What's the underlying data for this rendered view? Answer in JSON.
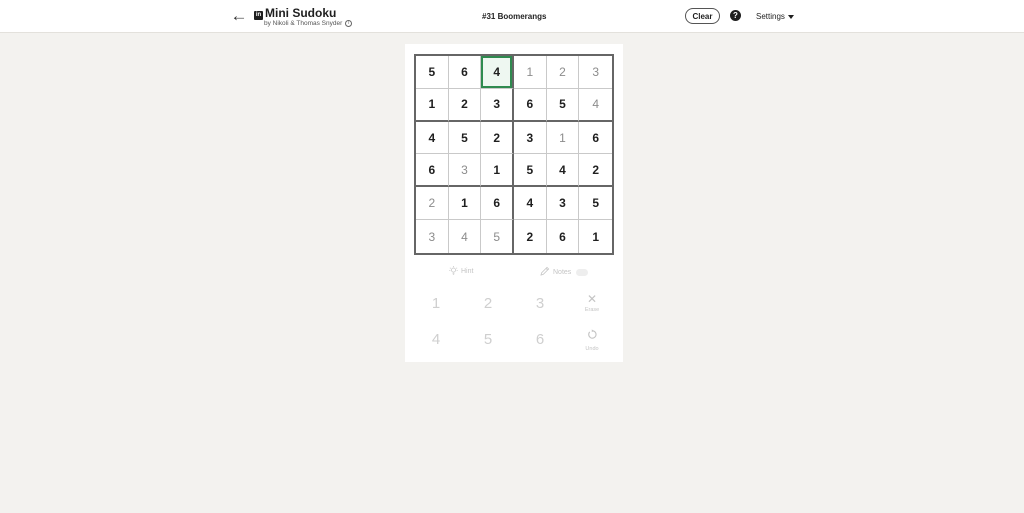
{
  "header": {
    "back_icon": "arrow-left-icon",
    "logo_text": "in",
    "title": "Mini Sudoku",
    "byline": "by Nikoli & Thomas Snyder",
    "info_glyph": "i",
    "puzzle_name": "#31 Boomerangs",
    "clear_label": "Clear",
    "help_glyph": "?",
    "settings_label": "Settings"
  },
  "grid": {
    "selected": [
      0,
      2
    ],
    "rows": [
      [
        {
          "v": "5",
          "t": "given"
        },
        {
          "v": "6",
          "t": "given"
        },
        {
          "v": "4",
          "t": "given"
        },
        {
          "v": "1",
          "t": "user"
        },
        {
          "v": "2",
          "t": "user"
        },
        {
          "v": "3",
          "t": "user"
        }
      ],
      [
        {
          "v": "1",
          "t": "given"
        },
        {
          "v": "2",
          "t": "given"
        },
        {
          "v": "3",
          "t": "given"
        },
        {
          "v": "6",
          "t": "given"
        },
        {
          "v": "5",
          "t": "given"
        },
        {
          "v": "4",
          "t": "user"
        }
      ],
      [
        {
          "v": "4",
          "t": "given"
        },
        {
          "v": "5",
          "t": "given"
        },
        {
          "v": "2",
          "t": "given"
        },
        {
          "v": "3",
          "t": "given"
        },
        {
          "v": "1",
          "t": "user"
        },
        {
          "v": "6",
          "t": "given"
        }
      ],
      [
        {
          "v": "6",
          "t": "given"
        },
        {
          "v": "3",
          "t": "user"
        },
        {
          "v": "1",
          "t": "given"
        },
        {
          "v": "5",
          "t": "given"
        },
        {
          "v": "4",
          "t": "given"
        },
        {
          "v": "2",
          "t": "given"
        }
      ],
      [
        {
          "v": "2",
          "t": "user"
        },
        {
          "v": "1",
          "t": "given"
        },
        {
          "v": "6",
          "t": "given"
        },
        {
          "v": "4",
          "t": "given"
        },
        {
          "v": "3",
          "t": "given"
        },
        {
          "v": "5",
          "t": "given"
        }
      ],
      [
        {
          "v": "3",
          "t": "user"
        },
        {
          "v": "4",
          "t": "user"
        },
        {
          "v": "5",
          "t": "user"
        },
        {
          "v": "2",
          "t": "given"
        },
        {
          "v": "6",
          "t": "given"
        },
        {
          "v": "1",
          "t": "given"
        }
      ]
    ]
  },
  "tools": {
    "hint_label": "Hint",
    "hint_icon": "lightbulb-icon",
    "notes_label": "Notes",
    "notes_icon": "pencil-icon"
  },
  "keypad": {
    "keys": [
      "1",
      "2",
      "3",
      "4",
      "5",
      "6"
    ],
    "erase_label": "Erase",
    "undo_label": "Undo"
  },
  "colors": {
    "background": "#f3f2ef",
    "selected_border": "#2f8a4f",
    "given_text": "#1f1f1f",
    "user_text": "#8c8c8c"
  }
}
